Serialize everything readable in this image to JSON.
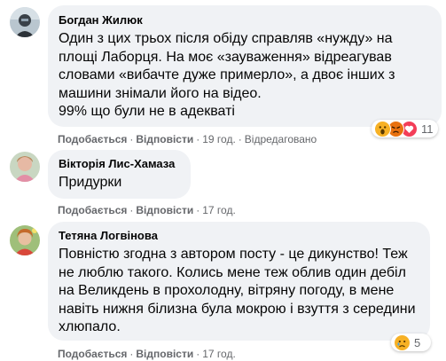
{
  "comments": [
    {
      "author": "Богдан Жилюк",
      "text": "Один з цих трьох після обіду справляв «нужду» на\nплощі Лаборця. На моє «зауваження» відреагував\nсловами «вибачте дуже примерло», а двоє інших з\nмашини знімали його на відео.\n99% що були не в адекваті",
      "like_label": "Подобається",
      "reply_label": "Відповісти",
      "time": "19 год.",
      "edited": "Відредаговано",
      "reaction_count": "11",
      "reactions": [
        "wow-face",
        "angry-face",
        "love-heart"
      ]
    },
    {
      "author": "Вікторія Лис-Хамаза",
      "text": "Придурки",
      "like_label": "Подобається",
      "reply_label": "Відповісти",
      "time": "17 год."
    },
    {
      "author": "Тетяна Логвінова",
      "text": "Повністю згодна з автором посту - це дикунство! Теж\nне люблю такого. Колись мене теж облив один дебіл\nна Великдень в прохолодну, вітряну погоду, в мене\nнавіть нижня білизна була мокрою і взуття з середини\nхлюпало.",
      "like_label": "Подобається",
      "reply_label": "Відповісти",
      "time": "17 год.",
      "reaction_count": "5",
      "reactions": [
        "sad-face"
      ]
    }
  ],
  "colors": {
    "bubble": "#f0f2f5",
    "meta_text": "#65676b",
    "wow": "#f7b125",
    "angry": "#e9710f",
    "love": "#f33e58",
    "sad": "#f7b125"
  }
}
